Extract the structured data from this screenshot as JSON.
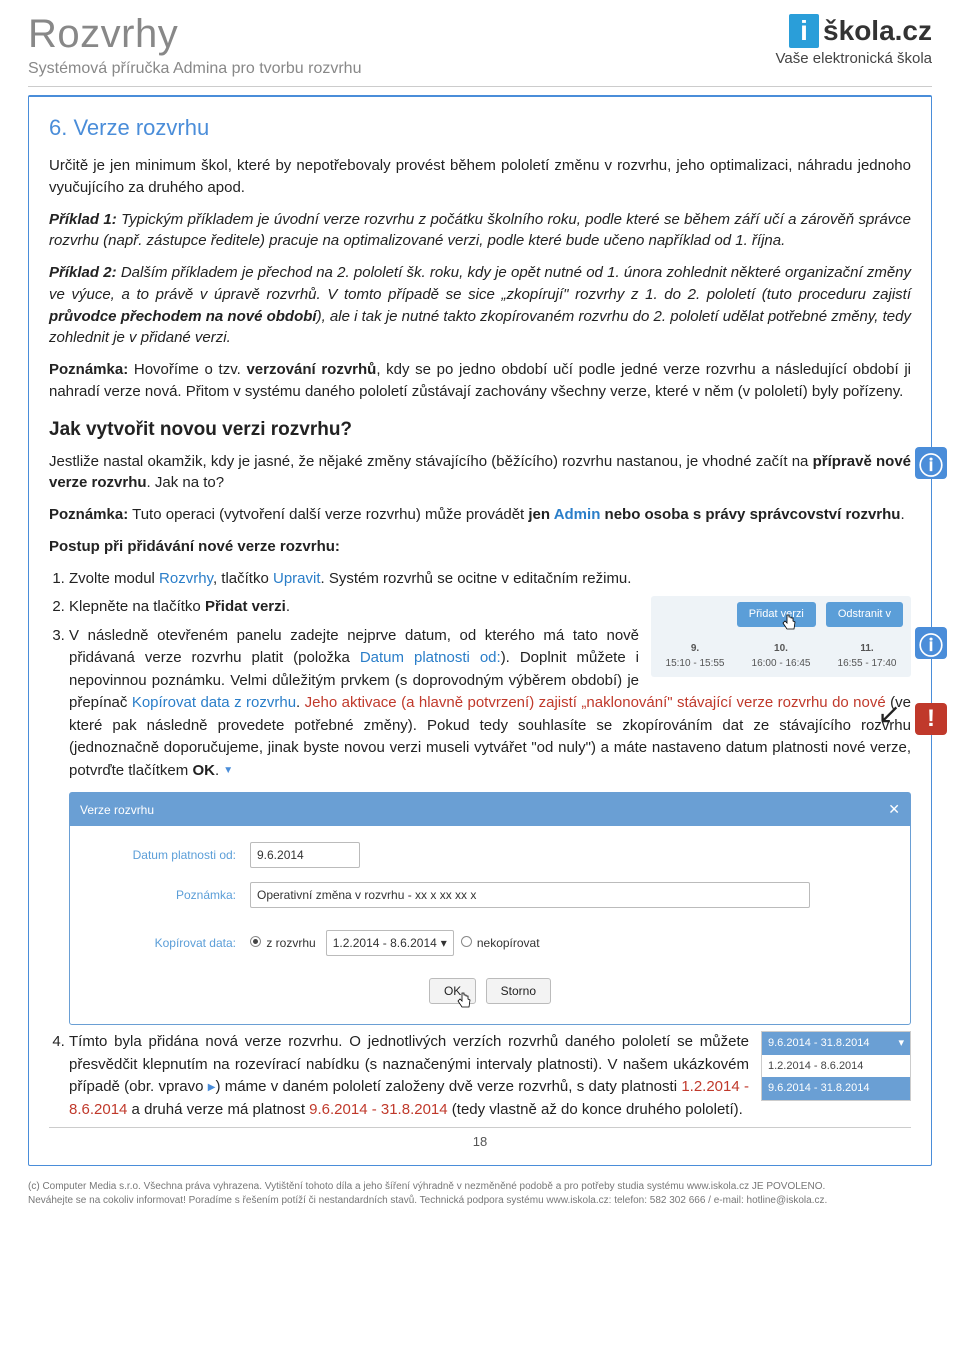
{
  "header": {
    "title": "Rozvrhy",
    "subtitle": "Systémová příručka Admina pro tvorbu rozvrhu",
    "logo_i": "i",
    "logo_text": "škola.cz",
    "logo_tagline": "Vaše elektronická škola"
  },
  "chapter": {
    "title": "6. Verze rozvrhu",
    "intro": "Určitě je jen minimum škol, které by nepotřebovaly provést během pololetí změnu v rozvrhu, jeho optimalizaci, náhradu jednoho vyučujícího za druhého apod.",
    "ex1_label": "Příklad 1:",
    "ex1_text": " Typickým příkladem je úvodní verze rozvrhu z počátku školního roku, podle které se během září učí a zárověň správce rozvrhu (např. zástupce ředitele) pracuje na optimalizované verzi, podle které bude učeno například od 1. října.",
    "ex2_label": "Příklad 2:",
    "ex2_text_a": " Dalším příkladem je přechod na 2. pololetí šk. roku, kdy je opět nutné od 1. února zohlednit některé organizační změny ve výuce, a to právě v úpravě rozvrhů. V tomto případě se sice „zkopírují\" rozvrhy z 1. do 2. pololetí (tuto proceduru zajistí ",
    "ex2_bold": "průvodce přechodem na nové období",
    "ex2_text_b": "), ale i tak je nutné takto zkopírovaném rozvrhu do 2. pololetí udělat potřebné změny, tedy zohlednit je v přidané verzi.",
    "note1_label": "Poznámka:",
    "note1_a": " Hovoříme o tzv. ",
    "note1_bold": "verzování rozvrhů",
    "note1_b": ", kdy se po jedno období učí podle jedné verze rozvrhu a následující období ji nahradí verze nová. Přitom v systému daného pololetí zůstávají zachovány všechny verze, které v něm (v pololetí) byly pořízeny."
  },
  "subchapter": {
    "title": "Jak vytvořit novou verzi rozvrhu?",
    "p1_a": "Jestliže nastal okamžik, kdy je jasné, že nějaké změny stávajícího (běžícího) rozvrhu nastanou, je vhodné začít na ",
    "p1_bold": "přípravě nové verze rozvrhu",
    "p1_b": ". Jak na to?",
    "note2_label": "Poznámka:",
    "note2_a": " Tuto operaci (vytvoření další verze rozvrhu) může provádět ",
    "note2_bold1": "jen ",
    "note2_blue": "Admin",
    "note2_bold2": " nebo osoba s právy správcovství rozvrhu",
    "note2_b": ".",
    "steps_title": "Postup při přidávání nové verze rozvrhu:",
    "step1_a": "Zvolte modul ",
    "step1_link1": "Rozvrhy",
    "step1_b": ", tlačítko ",
    "step1_link2": "Upravit",
    "step1_c": ". Systém rozvrhů se ocitne v editačním režimu.",
    "step2_a": "Klepněte na tlačítko ",
    "step2_bold": "Přidat verzi",
    "step2_b": ".",
    "step3_a": "V následně otevřeném panelu zadejte nejprve datum, od kterého má tato nově přidávaná verze rozvrhu platit (položka ",
    "step3_link1": "Datum platnosti od:",
    "step3_b": "). Doplnit můžete i nepovinnou poznámku. Velmi důležitým prvkem (s doprovodným výběrem období) je přepínač ",
    "step3_link2": "Kopírovat data z rozvrhu",
    "step3_c": ". ",
    "step3_red": "Jeho aktivace (a hlavně potvrzení) zajistí „naklonování\" stávající verze rozvrhu do nové",
    "step3_d": " (ve které pak následně provedete potřebné změny). Pokud tedy souhlasíte se zkopírováním dat ze stávajícího rozvrhu (jednoznačně doporučujeme, jinak byste novou verzi museli vytvářet \"od nuly\") a máte nastaveno datum platnosti nové verze, potvrďte tlačítkem ",
    "step3_bold": "OK",
    "step3_e": ". ",
    "step4_a": "Tímto byla přidána nová verze rozvrhu. O jednotlivých verzích rozvrhů daného pololetí se můžete přesvědčit klepnutím na rozevírací nabídku (s naznačenými intervaly platnosti). V našem ukázkovém případě (obr. vpravo ",
    "step4_b": ") máme v daném pololetí založeny dvě verze rozvrhů, s daty platnosti ",
    "step4_red1": "1.2.2014 - 8.6.2014",
    "step4_c": " a druhá verze má platnost ",
    "step4_red2": "9.6.2014 - 31.8.2014",
    "step4_d": " (tedy vlastně až do konce druhého pololetí)."
  },
  "mini": {
    "btn_add": "Přidat verzi",
    "btn_remove": "Odstranit v",
    "c1_num": "9.",
    "c1_time": "15:10 - 15:55",
    "c2_num": "10.",
    "c2_time": "16:00 - 16:45",
    "c3_num": "11.",
    "c3_time": "16:55 - 17:40"
  },
  "dialog": {
    "title": "Verze rozvrhu",
    "lbl_date": "Datum platnosti od:",
    "val_date": "9.6.2014",
    "lbl_note": "Poznámka:",
    "val_note": "Operativní změna v rozvrhu - xx x xx xx x",
    "lbl_copy": "Kopírovat data:",
    "opt1_label": "z rozvrhu",
    "opt1_val": "1.2.2014 - 8.6.2014",
    "opt2_label": "nekopírovat",
    "btn_ok": "OK",
    "btn_cancel": "Storno"
  },
  "dd": {
    "selected": "9.6.2014 - 31.8.2014",
    "opt1": "1.2.2014 - 8.6.2014",
    "opt2": "9.6.2014 - 31.8.2014"
  },
  "page_num": "18",
  "footer": {
    "line1": "(c) Computer Media s.r.o. Všechna práva vyhrazena. Vytištění tohoto díla a jeho šíření výhradně v nezměněné podobě a pro potřeby studia systému www.iskola.cz JE POVOLENO.",
    "line2": "Neváhejte se na cokoliv informovat! Poradíme s řešením potíží či nestandardních stavů. Technická podpora systému www.iskola.cz: telefon: 582 302 666 / e-mail: hotline@iskola.cz."
  }
}
